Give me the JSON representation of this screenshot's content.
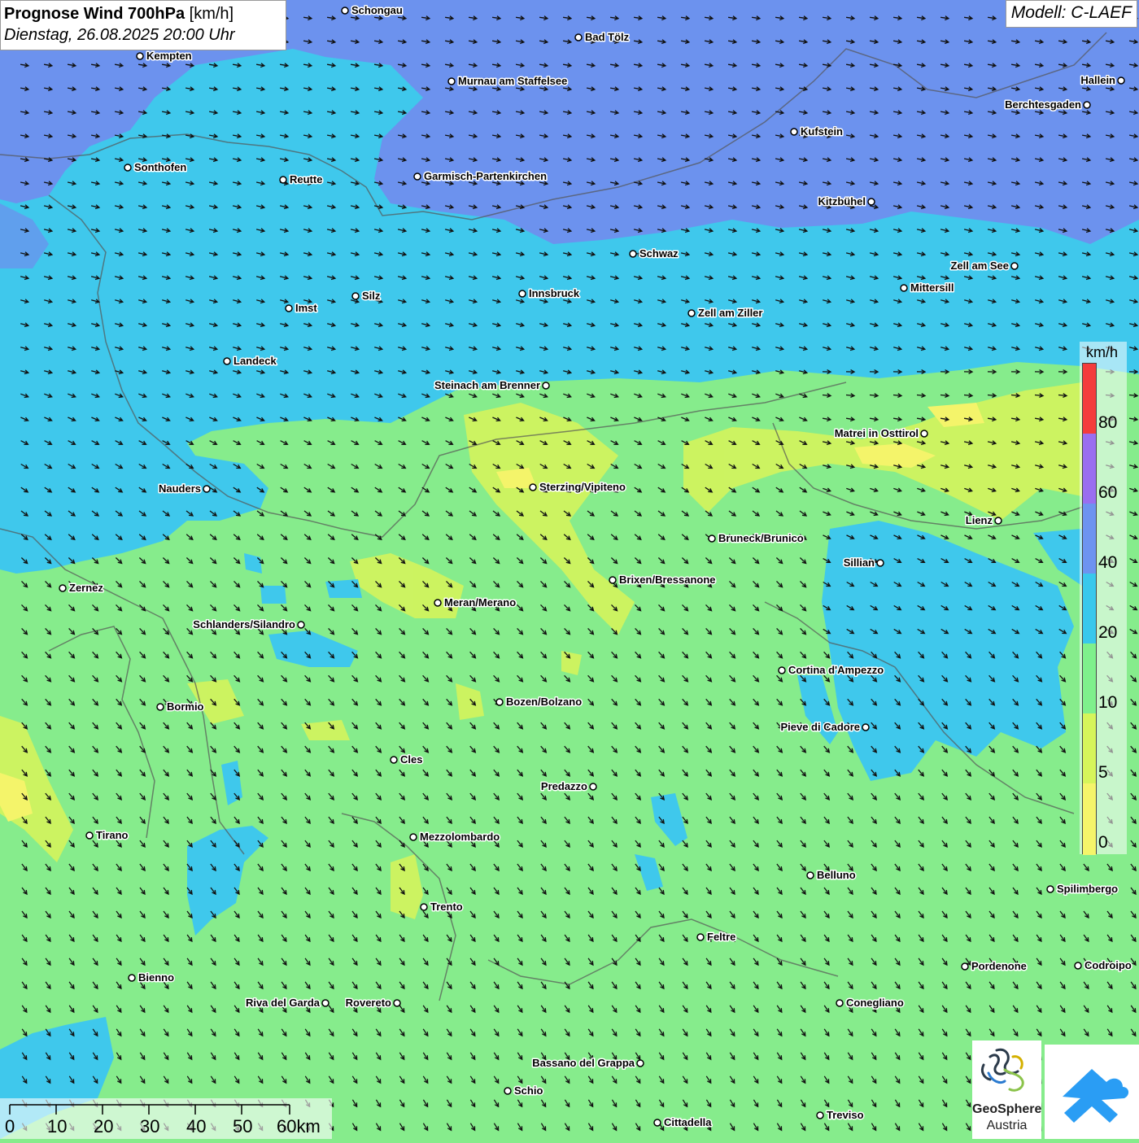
{
  "title": {
    "bold": "Prognose Wind 700hPa",
    "unit": " [km/h]",
    "date": "Dienstag, 26.08.2025 20:00 Uhr"
  },
  "model_label": "Modell: C-LAEF",
  "legend": {
    "unit": "km/h",
    "ticks": [
      "80",
      "60",
      "40",
      "20",
      "10",
      "5",
      "0"
    ],
    "colors": {
      "80_plus": "#f43c3c",
      "60_80": "#9a6ef0",
      "40_60": "#6d93f0",
      "20_40": "#38c8ec",
      "10_20": "#7ff08c",
      "5_10": "#d6f55a",
      "0_5": "#f5f56a"
    }
  },
  "scalebar": {
    "labels": [
      "0",
      "10",
      "20",
      "30",
      "40",
      "50",
      "60km"
    ]
  },
  "logos": {
    "geosphere_name": "GeoSphere",
    "geosphere_sub": "Austria"
  },
  "cities": [
    {
      "name": "Schongau",
      "label_side": "right"
    },
    {
      "name": "Bad Tölz",
      "label_side": "right"
    },
    {
      "name": "Kempten",
      "label_side": "right"
    },
    {
      "name": "Murnau am Staffelsee",
      "label_side": "right"
    },
    {
      "name": "Hallein",
      "label_side": "left"
    },
    {
      "name": "Berchtesgaden",
      "label_side": "left"
    },
    {
      "name": "Kufstein",
      "label_side": "right"
    },
    {
      "name": "Sonthofen",
      "label_side": "right"
    },
    {
      "name": "Reutte",
      "label_side": "right"
    },
    {
      "name": "Garmisch-Partenkirchen",
      "label_side": "right"
    },
    {
      "name": "Kitzbühel",
      "label_side": "left"
    },
    {
      "name": "Schwaz",
      "label_side": "right"
    },
    {
      "name": "Zell am See",
      "label_side": "left"
    },
    {
      "name": "Mittersill",
      "label_side": "right"
    },
    {
      "name": "Innsbruck",
      "label_side": "right"
    },
    {
      "name": "Silz",
      "label_side": "right"
    },
    {
      "name": "Imst",
      "label_side": "right"
    },
    {
      "name": "Zell am Ziller",
      "label_side": "right"
    },
    {
      "name": "Landeck",
      "label_side": "right"
    },
    {
      "name": "Steinach am Brenner",
      "label_side": "left"
    },
    {
      "name": "Matrei in Osttirol",
      "label_side": "left"
    },
    {
      "name": "Nauders",
      "label_side": "left"
    },
    {
      "name": "Sterzing/Vipiteno",
      "label_side": "right"
    },
    {
      "name": "Lienz",
      "label_side": "left"
    },
    {
      "name": "Bruneck/Brunico",
      "label_side": "right"
    },
    {
      "name": "Sillian",
      "label_side": "left"
    },
    {
      "name": "Brixen/Bressanone",
      "label_side": "right"
    },
    {
      "name": "Zernez",
      "label_side": "right"
    },
    {
      "name": "Meran/Merano",
      "label_side": "right"
    },
    {
      "name": "Schlanders/Silandro",
      "label_side": "left"
    },
    {
      "name": "Cortina d'Ampezzo",
      "label_side": "right"
    },
    {
      "name": "Bozen/Bolzano",
      "label_side": "right"
    },
    {
      "name": "Bormio",
      "label_side": "right"
    },
    {
      "name": "Pieve di Cadore",
      "label_side": "left"
    },
    {
      "name": "Cles",
      "label_side": "right"
    },
    {
      "name": "Predazzo",
      "label_side": "left"
    },
    {
      "name": "Tirano",
      "label_side": "right"
    },
    {
      "name": "Mezzolombardo",
      "label_side": "right"
    },
    {
      "name": "Belluno",
      "label_side": "right"
    },
    {
      "name": "Spilimbergo",
      "label_side": "right"
    },
    {
      "name": "Trento",
      "label_side": "right"
    },
    {
      "name": "Feltre",
      "label_side": "right"
    },
    {
      "name": "Pordenone",
      "label_side": "right"
    },
    {
      "name": "Codroipo",
      "label_side": "right"
    },
    {
      "name": "Bienno",
      "label_side": "right"
    },
    {
      "name": "Riva del Garda",
      "label_side": "left"
    },
    {
      "name": "Rovereto",
      "label_side": "left"
    },
    {
      "name": "Conegliano",
      "label_side": "right"
    },
    {
      "name": "Bassano del Grappa",
      "label_side": "left"
    },
    {
      "name": "Schio",
      "label_side": "right"
    },
    {
      "name": "Treviso",
      "label_side": "right"
    },
    {
      "name": "Cittadella",
      "label_side": "right"
    }
  ]
}
